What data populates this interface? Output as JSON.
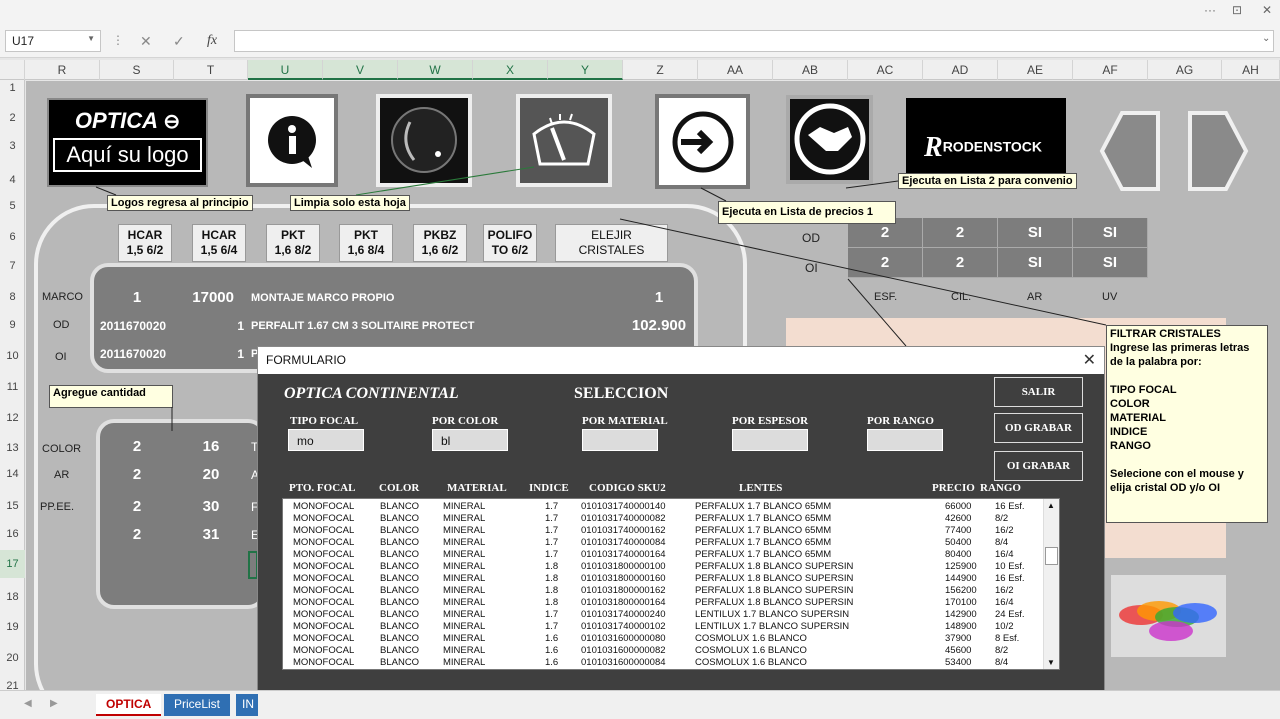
{
  "window": {
    "more": "···",
    "restore": "⊡",
    "close": "✕"
  },
  "namebox": {
    "value": "U17"
  },
  "formula_bar": {
    "cancel": "✕",
    "enter": "✓",
    "fx": "fx"
  },
  "columns": [
    "R",
    "S",
    "T",
    "U",
    "V",
    "W",
    "X",
    "Y",
    "Z",
    "AA",
    "AB",
    "AC",
    "AD",
    "AE",
    "AF",
    "AG",
    "AH"
  ],
  "rows": [
    "1",
    "2",
    "3",
    "4",
    "5",
    "6",
    "7",
    "8",
    "9",
    "10",
    "11",
    "12",
    "13",
    "14",
    "15",
    "16",
    "17",
    "18",
    "19",
    "20",
    "21"
  ],
  "logo": {
    "brand": "OPTICA",
    "placeholder": "Aquí su logo"
  },
  "rodenstock": "RODENSTOCK",
  "notes": {
    "logos": "Logos regresa al principio",
    "limpia": "Limpia solo esta hoja",
    "lista1": "Ejecuta en Lista de precios 1",
    "lista2": "Ejecuta en Lista 2 para convenio",
    "agregue": "Agregue cantidad",
    "filtrar": [
      "FILTRAR CRISTALES",
      "Ingrese las primeras letras",
      "de la palabra por:",
      "",
      "TIPO FOCAL",
      "COLOR",
      "MATERIAL",
      "INDICE",
      "RANGO",
      "",
      "Selecione con el mouse y",
      "elija cristal OD y/o OI"
    ]
  },
  "lens_buttons": [
    {
      "l1": "HCAR",
      "l2": "1,5 6/2"
    },
    {
      "l1": "HCAR",
      "l2": "1,5 6/4"
    },
    {
      "l1": "PKT",
      "l2": "1,6 8/2"
    },
    {
      "l1": "PKT",
      "l2": "1,6 8/4"
    },
    {
      "l1": "PKBZ",
      "l2": "1,6  6/2"
    },
    {
      "l1": "POLIFO",
      "l2": "TO  6/2"
    }
  ],
  "elegir": {
    "l1": "ELEJIR",
    "l2": "CRISTALES"
  },
  "specs": {
    "od_label": "OD",
    "oi_label": "OI",
    "od": [
      "2",
      "2",
      "SI",
      "SI"
    ],
    "oi": [
      "2",
      "2",
      "SI",
      "SI"
    ],
    "headers": [
      "ESF.",
      "CIL.",
      "AR",
      "UV"
    ]
  },
  "order_rows": [
    {
      "label": "MARCO",
      "a": "1",
      "b": "17000",
      "desc": "MONTAJE MARCO PROPIO",
      "val": "1"
    },
    {
      "label": "OD",
      "a": "2011670020",
      "b": "1",
      "desc": "PERFALIT 1.67 CM 3 SOLITAIRE PROTECT",
      "val": "102.900"
    },
    {
      "label": "OI",
      "a": "2011670020",
      "b": "1",
      "desc": "P",
      "val": ""
    }
  ],
  "extras": [
    {
      "label": "COLOR",
      "a": "2",
      "b": "16",
      "c": "T"
    },
    {
      "label": "AR",
      "a": "2",
      "b": "20",
      "c": "A"
    },
    {
      "label": "PP.EE.",
      "a": "2",
      "b": "30",
      "c": "F"
    },
    {
      "label": "",
      "a": "2",
      "b": "31",
      "c": "E"
    }
  ],
  "dialog": {
    "title": "FORMULARIO",
    "close": "✕",
    "brand": "OPTICA CONTINENTAL",
    "heading": "SELECCION",
    "filters": [
      {
        "label": "TIPO  FOCAL",
        "value": "mo"
      },
      {
        "label": "POR COLOR",
        "value": "bl"
      },
      {
        "label": "POR MATERIAL",
        "value": ""
      },
      {
        "label": "POR ESPESOR",
        "value": ""
      },
      {
        "label": "POR RANGO",
        "value": ""
      }
    ],
    "buttons": {
      "salir": "SALIR",
      "od": "OD GRABAR",
      "oi": "OI GRABAR"
    },
    "columns": [
      "PTO. FOCAL",
      "COLOR",
      "MATERIAL",
      "INDICE",
      "CODIGO SKU2",
      "LENTES",
      "PRECIO",
      "RANGO"
    ],
    "rows": [
      [
        "MONOFOCAL",
        "BLANCO",
        "MINERAL",
        "1.7",
        "0101031740000140",
        "PERFALUX 1.7 BLANCO 65MM",
        "66000",
        "16 Esf."
      ],
      [
        "MONOFOCAL",
        "BLANCO",
        "MINERAL",
        "1.7",
        "0101031740000082",
        "PERFALUX 1.7 BLANCO 65MM",
        "42600",
        "8/2"
      ],
      [
        "MONOFOCAL",
        "BLANCO",
        "MINERAL",
        "1.7",
        "0101031740000162",
        "PERFALUX 1.7 BLANCO 65MM",
        "77400",
        "16/2"
      ],
      [
        "MONOFOCAL",
        "BLANCO",
        "MINERAL",
        "1.7",
        "0101031740000084",
        "PERFALUX 1.7 BLANCO 65MM",
        "50400",
        "8/4"
      ],
      [
        "MONOFOCAL",
        "BLANCO",
        "MINERAL",
        "1.7",
        "0101031740000164",
        "PERFALUX 1.7 BLANCO 65MM",
        "80400",
        "16/4"
      ],
      [
        "MONOFOCAL",
        "BLANCO",
        "MINERAL",
        "1.8",
        "0101031800000100",
        "PERFALUX 1.8 BLANCO SUPERSIN",
        "125900",
        "10 Esf."
      ],
      [
        "MONOFOCAL",
        "BLANCO",
        "MINERAL",
        "1.8",
        "0101031800000160",
        "PERFALUX 1.8 BLANCO SUPERSIN",
        "144900",
        "16 Esf."
      ],
      [
        "MONOFOCAL",
        "BLANCO",
        "MINERAL",
        "1.8",
        "0101031800000162",
        "PERFALUX 1.8 BLANCO SUPERSIN",
        "156200",
        "16/2"
      ],
      [
        "MONOFOCAL",
        "BLANCO",
        "MINERAL",
        "1.8",
        "0101031800000164",
        "PERFALUX 1.8 BLANCO SUPERSIN",
        "170100",
        "16/4"
      ],
      [
        "MONOFOCAL",
        "BLANCO",
        "MINERAL",
        "1.7",
        "0101031740000240",
        "LENTILUX 1.7 BLANCO SUPERSIN",
        "142900",
        "24 Esf."
      ],
      [
        "MONOFOCAL",
        "BLANCO",
        "MINERAL",
        "1.7",
        "0101031740000102",
        "LENTILUX 1.7 BLANCO SUPERSIN",
        "148900",
        "10/2"
      ],
      [
        "MONOFOCAL",
        "BLANCO",
        "MINERAL",
        "1.6",
        "0101031600000080",
        "COSMOLUX 1.6 BLANCO",
        "37900",
        "8 Esf."
      ],
      [
        "MONOFOCAL",
        "BLANCO",
        "MINERAL",
        "1.6",
        "0101031600000082",
        "COSMOLUX 1.6 BLANCO",
        "45600",
        "8/2"
      ],
      [
        "MONOFOCAL",
        "BLANCO",
        "MINERAL",
        "1.6",
        "0101031600000084",
        "COSMOLUX 1.6 BLANCO",
        "53400",
        "8/4"
      ]
    ]
  },
  "tabs": [
    "OPTICA",
    "PriceList",
    "IN"
  ]
}
